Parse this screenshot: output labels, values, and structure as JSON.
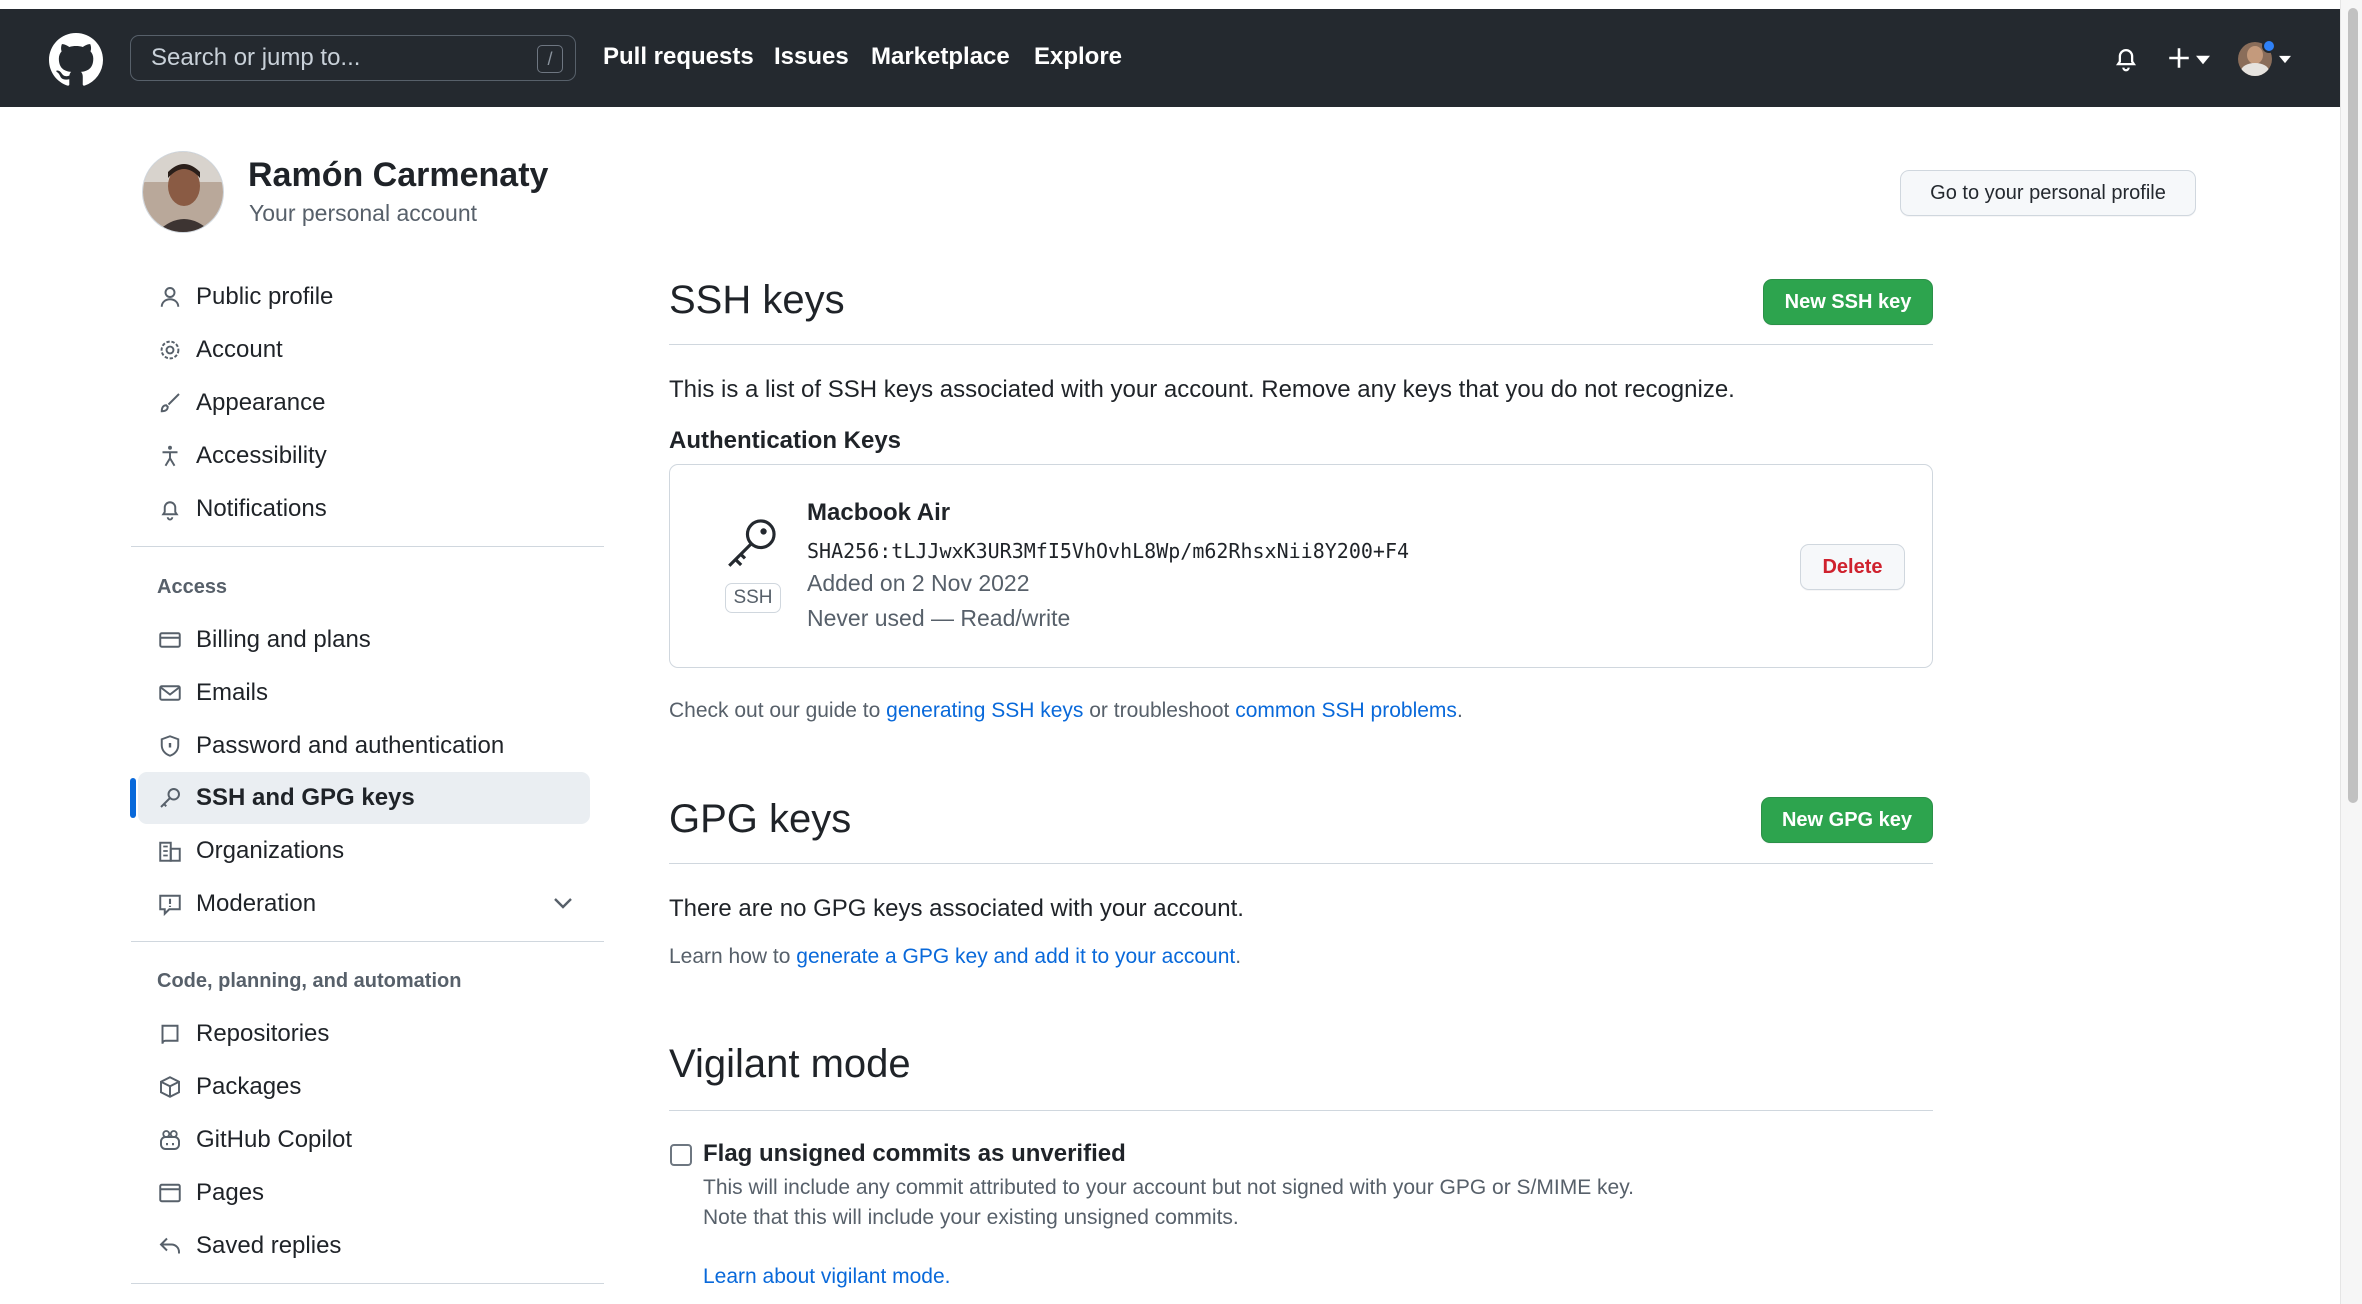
{
  "header": {
    "search_placeholder": "Search or jump to...",
    "search_shortcut": "/",
    "nav": [
      "Pull requests",
      "Issues",
      "Marketplace",
      "Explore"
    ],
    "icons": [
      "github-logo-icon",
      "bell-icon",
      "plus-icon",
      "avatar"
    ]
  },
  "profile": {
    "name": "Ramón Carmenaty",
    "subtitle": "Your personal account",
    "go_profile_button": "Go to your personal profile"
  },
  "sidebar": {
    "group1": [
      {
        "label": "Public profile",
        "icon": "person-icon"
      },
      {
        "label": "Account",
        "icon": "gear-icon"
      },
      {
        "label": "Appearance",
        "icon": "paintbrush-icon"
      },
      {
        "label": "Accessibility",
        "icon": "accessibility-icon"
      },
      {
        "label": "Notifications",
        "icon": "bell-icon"
      }
    ],
    "access_heading": "Access",
    "group2": [
      {
        "label": "Billing and plans",
        "icon": "credit-card-icon"
      },
      {
        "label": "Emails",
        "icon": "mail-icon"
      },
      {
        "label": "Password and authentication",
        "icon": "shield-icon"
      },
      {
        "label": "SSH and GPG keys",
        "icon": "key-icon",
        "active": true
      },
      {
        "label": "Organizations",
        "icon": "organization-icon"
      },
      {
        "label": "Moderation",
        "icon": "report-icon"
      }
    ],
    "code_heading": "Code, planning, and automation",
    "group3": [
      {
        "label": "Repositories",
        "icon": "repo-icon"
      },
      {
        "label": "Packages",
        "icon": "package-icon"
      },
      {
        "label": "GitHub Copilot",
        "icon": "copilot-icon"
      },
      {
        "label": "Pages",
        "icon": "browser-icon"
      },
      {
        "label": "Saved replies",
        "icon": "reply-icon"
      }
    ]
  },
  "ssh": {
    "title": "SSH keys",
    "new_button": "New SSH key",
    "description": "This is a list of SSH keys associated with your account. Remove any keys that you do not recognize.",
    "auth_heading": "Authentication Keys",
    "key": {
      "badge": "SSH",
      "name": "Macbook Air",
      "fingerprint": "SHA256:tLJJwxK3UR3MfI5VhOvhL8Wp/m62RhsxNii8Y200+F4",
      "added": "Added on 2 Nov 2022",
      "usage": "Never used — Read/write",
      "delete_button": "Delete"
    },
    "guide_prefix": "Check out our guide to ",
    "guide_link1": "generating SSH keys",
    "guide_middle": " or troubleshoot ",
    "guide_link2": "common SSH problems",
    "guide_suffix": "."
  },
  "gpg": {
    "title": "GPG keys",
    "new_button": "New GPG key",
    "empty": "There are no GPG keys associated with your account.",
    "learn_prefix": "Learn how to ",
    "learn_link": "generate a GPG key and add it to your account",
    "learn_suffix": "."
  },
  "vigilant": {
    "title": "Vigilant mode",
    "checkbox_label": "Flag unsigned commits as unverified",
    "checked": false,
    "desc1": "This will include any commit attributed to your account but not signed with your GPG or S/MIME key.",
    "desc2": "Note that this will include your existing unsigned commits.",
    "learn_link": "Learn about vigilant mode."
  }
}
